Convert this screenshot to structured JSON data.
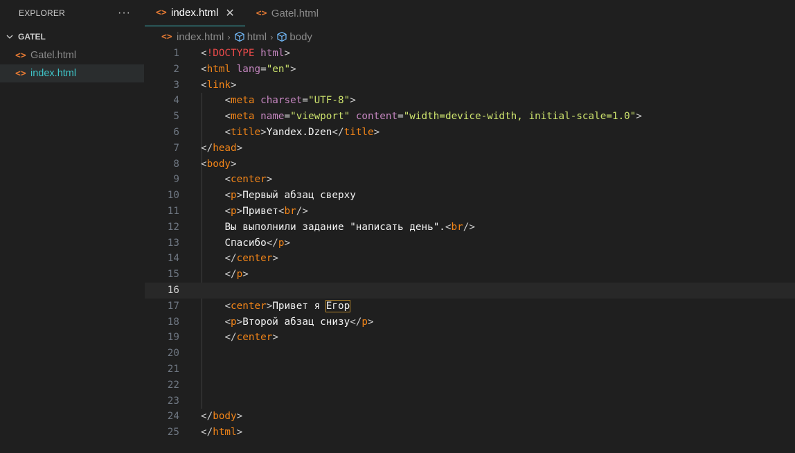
{
  "sidebar": {
    "title": "EXPLORER",
    "more": "···",
    "folder": "GATEL",
    "files": [
      {
        "name": "Gatel.html",
        "active": false
      },
      {
        "name": "index.html",
        "active": true
      }
    ]
  },
  "tabs": [
    {
      "label": "index.html",
      "active": true
    },
    {
      "label": "Gatel.html",
      "active": false
    }
  ],
  "breadcrumb": [
    "index.html",
    "html",
    "body"
  ],
  "editor": {
    "current_line": 16,
    "lines": [
      {
        "n": "1",
        "indent": "",
        "tokens": [
          [
            "punc",
            "<"
          ],
          [
            "tag2",
            "!DOCTYPE"
          ],
          [
            "punc",
            " "
          ],
          [
            "attr",
            "html"
          ],
          [
            "punc",
            ">"
          ]
        ]
      },
      {
        "n": "2",
        "indent": "",
        "tokens": [
          [
            "punc",
            "<"
          ],
          [
            "tag",
            "html"
          ],
          [
            "punc",
            " "
          ],
          [
            "attr",
            "lang"
          ],
          [
            "punc",
            "="
          ],
          [
            "str",
            "\"en\""
          ],
          [
            "punc",
            ">"
          ]
        ]
      },
      {
        "n": "3",
        "indent": "",
        "tokens": [
          [
            "punc",
            "<"
          ],
          [
            "tag",
            "link"
          ],
          [
            "punc",
            ">"
          ]
        ]
      },
      {
        "n": "4",
        "indent": "    ",
        "tokens": [
          [
            "punc",
            "<"
          ],
          [
            "tag",
            "meta"
          ],
          [
            "punc",
            " "
          ],
          [
            "attr",
            "charset"
          ],
          [
            "punc",
            "="
          ],
          [
            "str",
            "\"UTF-8\""
          ],
          [
            "punc",
            ">"
          ]
        ]
      },
      {
        "n": "5",
        "indent": "    ",
        "tokens": [
          [
            "punc",
            "<"
          ],
          [
            "tag",
            "meta"
          ],
          [
            "punc",
            " "
          ],
          [
            "attr",
            "name"
          ],
          [
            "punc",
            "="
          ],
          [
            "str",
            "\"viewport\""
          ],
          [
            "punc",
            " "
          ],
          [
            "attr",
            "content"
          ],
          [
            "punc",
            "="
          ],
          [
            "str",
            "\"width=device-width, initial-scale=1.0\""
          ],
          [
            "punc",
            ">"
          ]
        ]
      },
      {
        "n": "6",
        "indent": "    ",
        "tokens": [
          [
            "punc",
            "<"
          ],
          [
            "tag",
            "title"
          ],
          [
            "punc",
            ">"
          ],
          [
            "txt",
            "Yandex.Dzen"
          ],
          [
            "punc",
            "</"
          ],
          [
            "tag",
            "title"
          ],
          [
            "punc",
            ">"
          ]
        ]
      },
      {
        "n": "7",
        "indent": "",
        "tokens": [
          [
            "punc",
            "</"
          ],
          [
            "tag",
            "head"
          ],
          [
            "punc",
            ">"
          ]
        ]
      },
      {
        "n": "8",
        "indent": "",
        "tokens": [
          [
            "punc",
            "<"
          ],
          [
            "tag",
            "body"
          ],
          [
            "punc",
            ">"
          ]
        ]
      },
      {
        "n": "9",
        "indent": "    ",
        "tokens": [
          [
            "punc",
            "<"
          ],
          [
            "tag",
            "center"
          ],
          [
            "punc",
            ">"
          ]
        ]
      },
      {
        "n": "10",
        "indent": "    ",
        "tokens": [
          [
            "punc",
            "<"
          ],
          [
            "tag",
            "p"
          ],
          [
            "punc",
            ">"
          ],
          [
            "txt",
            "Первый абзац сверху"
          ]
        ]
      },
      {
        "n": "11",
        "indent": "    ",
        "tokens": [
          [
            "punc",
            "<"
          ],
          [
            "tag",
            "p"
          ],
          [
            "punc",
            ">"
          ],
          [
            "txt",
            "Привет"
          ],
          [
            "punc",
            "<"
          ],
          [
            "tag",
            "br"
          ],
          [
            "punc",
            "/>"
          ]
        ]
      },
      {
        "n": "12",
        "indent": "    ",
        "tokens": [
          [
            "txt",
            "Вы выполнили задание \"написать день\"."
          ],
          [
            "punc",
            "<"
          ],
          [
            "tag",
            "br"
          ],
          [
            "punc",
            "/>"
          ]
        ]
      },
      {
        "n": "13",
        "indent": "    ",
        "tokens": [
          [
            "txt",
            "Спасибо"
          ],
          [
            "punc",
            "</"
          ],
          [
            "tag",
            "p"
          ],
          [
            "punc",
            ">"
          ]
        ]
      },
      {
        "n": "14",
        "indent": "    ",
        "tokens": [
          [
            "punc",
            "</"
          ],
          [
            "tag",
            "center"
          ],
          [
            "punc",
            ">"
          ]
        ]
      },
      {
        "n": "15",
        "indent": "    ",
        "tokens": [
          [
            "punc",
            "</"
          ],
          [
            "tag",
            "p"
          ],
          [
            "punc",
            ">"
          ]
        ]
      },
      {
        "n": "16",
        "indent": "",
        "tokens": []
      },
      {
        "n": "17",
        "indent": "    ",
        "tokens": [
          [
            "punc",
            "<"
          ],
          [
            "tag",
            "center"
          ],
          [
            "punc",
            ">"
          ],
          [
            "txt",
            "Привет я "
          ],
          [
            "txt hl",
            "Егор"
          ]
        ]
      },
      {
        "n": "18",
        "indent": "    ",
        "tokens": [
          [
            "punc",
            "<"
          ],
          [
            "tag",
            "p"
          ],
          [
            "punc",
            ">"
          ],
          [
            "txt",
            "Второй абзац снизу"
          ],
          [
            "punc",
            "</"
          ],
          [
            "tag",
            "p"
          ],
          [
            "punc",
            ">"
          ]
        ]
      },
      {
        "n": "19",
        "indent": "    ",
        "tokens": [
          [
            "punc",
            "</"
          ],
          [
            "tag",
            "center"
          ],
          [
            "punc",
            ">"
          ]
        ]
      },
      {
        "n": "20",
        "indent": "",
        "tokens": []
      },
      {
        "n": "21",
        "indent": "",
        "tokens": []
      },
      {
        "n": "22",
        "indent": "",
        "tokens": []
      },
      {
        "n": "23",
        "indent": "",
        "tokens": []
      },
      {
        "n": "24",
        "indent": "",
        "tokens": [
          [
            "punc",
            "</"
          ],
          [
            "tag",
            "body"
          ],
          [
            "punc",
            ">"
          ]
        ]
      },
      {
        "n": "25",
        "indent": "",
        "tokens": [
          [
            "punc",
            "</"
          ],
          [
            "tag",
            "html"
          ],
          [
            "punc",
            ">"
          ]
        ]
      }
    ]
  }
}
